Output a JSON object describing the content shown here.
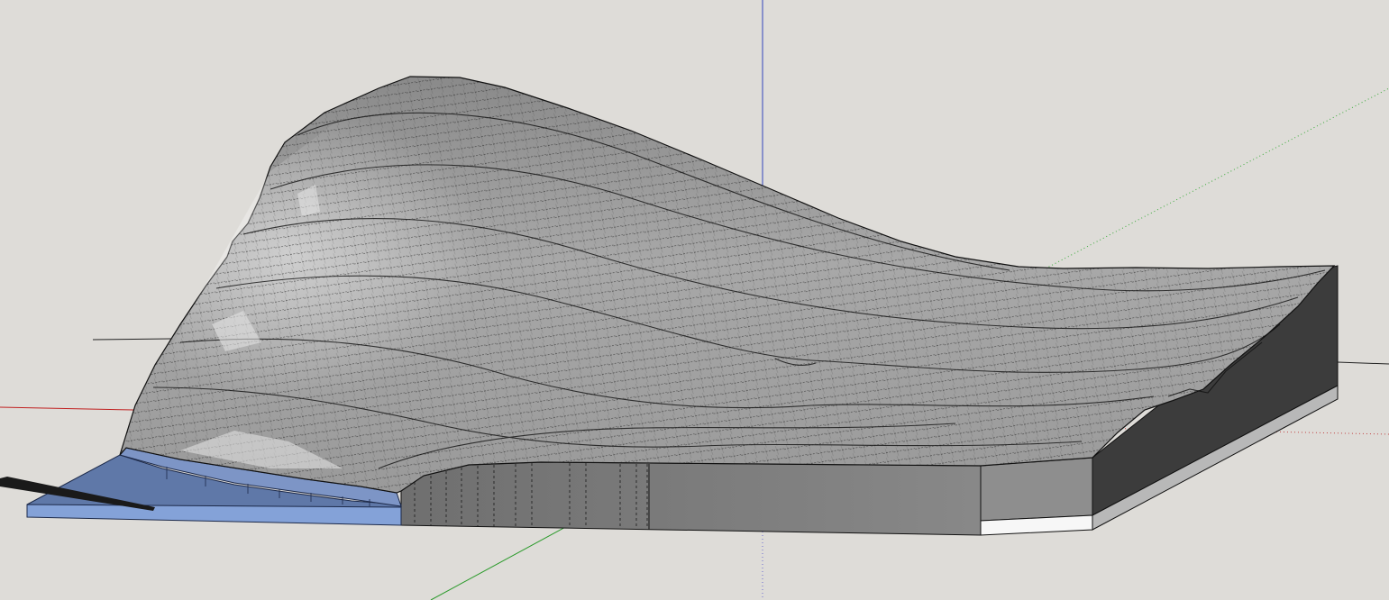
{
  "viewport": {
    "background_color": "#dedcd8",
    "axes": {
      "red_axis_color": "#cc2222",
      "green_axis_color": "#22aa22",
      "blue_axis_color": "#3333cc",
      "dotted_hidden_segments": true
    },
    "model": {
      "type": "terrain-mesh",
      "surface_color": "#9c9c9c",
      "edge_color": "#111111",
      "base_side_color": "#7c7c7c",
      "dark_side_color": "#3a3a3a",
      "selected_face_color": "#7d96c8"
    }
  }
}
